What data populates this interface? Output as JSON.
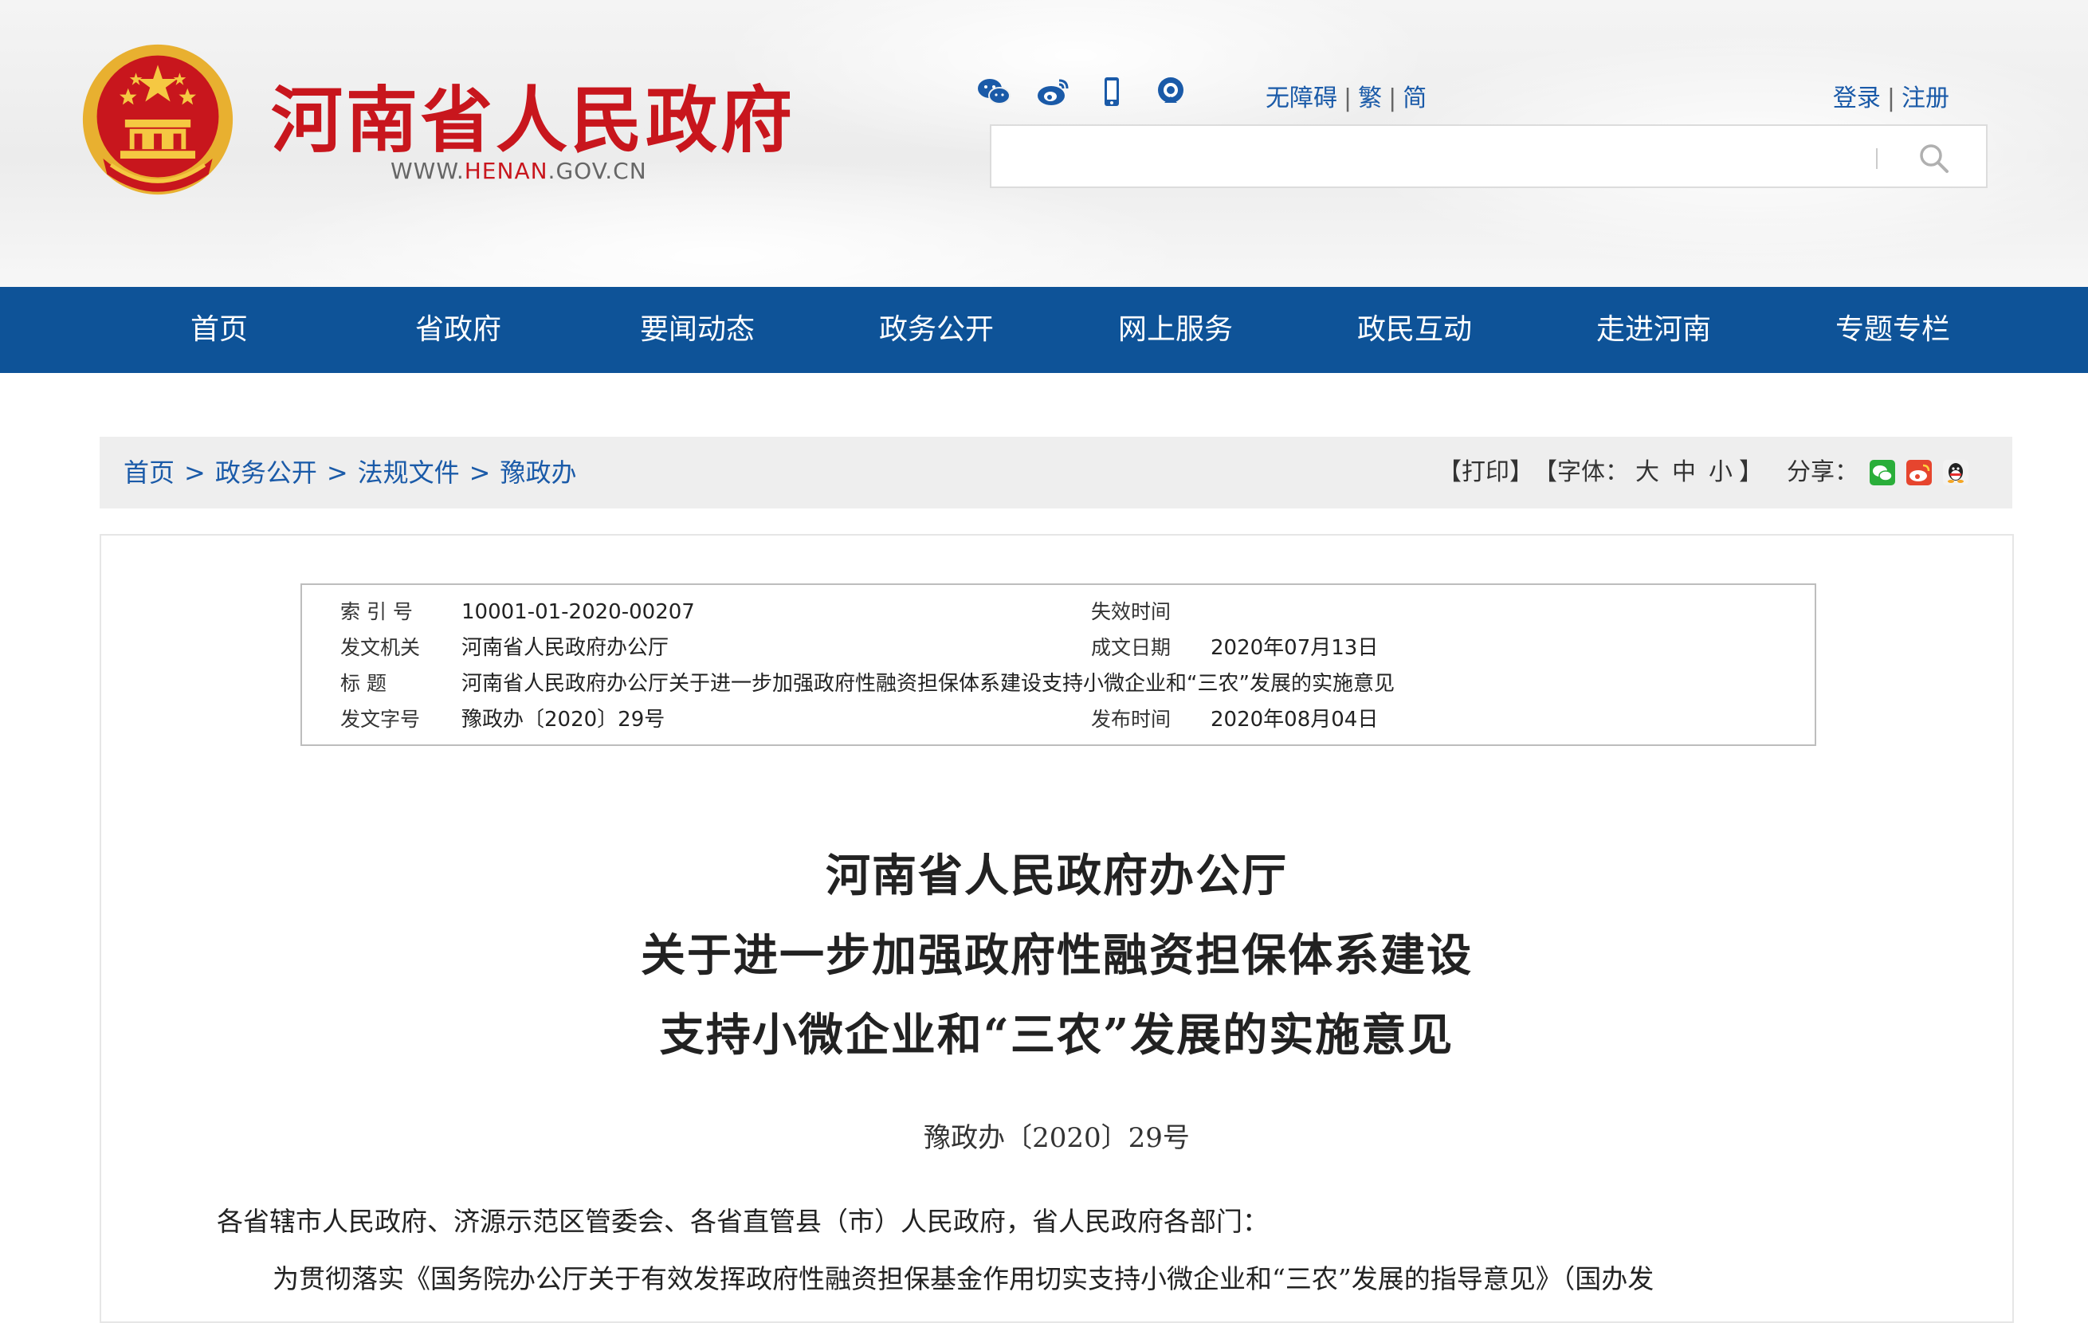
{
  "header": {
    "site_title": "河南省人民政府",
    "url_prefix": "WWW.",
    "url_highlight": "HENAN",
    "url_suffix": ".GOV.CN",
    "social_icons": [
      "wechat-icon",
      "weibo-icon",
      "mobile-icon",
      "podcast-icon"
    ],
    "accessibility_links": [
      "无障碍",
      "繁",
      "简"
    ],
    "login": "登录",
    "register": "注册",
    "separator": "|",
    "search_value": "",
    "emblem_color": "#c8161d",
    "title_color": "#c8161d"
  },
  "nav": {
    "items": [
      "首页",
      "省政府",
      "要闻动态",
      "政务公开",
      "网上服务",
      "政民互动",
      "走进河南",
      "专题专栏"
    ],
    "background": "#0e5398"
  },
  "breadcrumb": {
    "items": [
      "首页",
      "政务公开",
      "法规文件",
      "豫政办"
    ],
    "separator": ">"
  },
  "tools": {
    "print": "【打印】",
    "font_label": "【字体：",
    "font_large": "大",
    "font_medium": "中",
    "font_small": "小",
    "font_close": "】",
    "share_label": "分享：",
    "share_icons": [
      "wechat-share-icon",
      "weibo-share-icon",
      "qq-share-icon"
    ]
  },
  "meta": {
    "index_label": "索  引  号",
    "index_value": "10001-01-2020-00207",
    "expire_label": "失效时间",
    "expire_value": "",
    "issuer_label": "发文机关",
    "issuer_value": "河南省人民政府办公厅",
    "written_label": "成文日期",
    "written_value": "2020年07月13日",
    "title_label": "标       题",
    "title_value": "河南省人民政府办公厅关于进一步加强政府性融资担保体系建设支持小微企业和“三农”发展的实施意见",
    "docno_label": "发文字号",
    "docno_value": "豫政办〔2020〕29号",
    "publish_label": "发布时间",
    "publish_value": "2020年08月04日"
  },
  "article": {
    "title_lines": [
      "河南省人民政府办公厅",
      "关于进一步加强政府性融资担保体系建设",
      "支持小微企业和“三农”发展的实施意见"
    ],
    "doc_number": "豫政办〔2020〕29号",
    "salutation": "各省辖市人民政府、济源示范区管委会、各省直管县（市）人民政府，省人民政府各部门：",
    "paragraph_1": "为贯彻落实《国务院办公厅关于有效发挥政府性融资担保基金作用切实支持小微企业和“三农”发展的指导意见》（国办发"
  }
}
